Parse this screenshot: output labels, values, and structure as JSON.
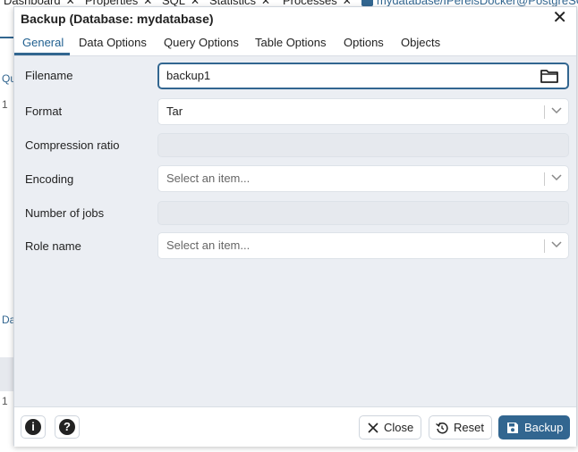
{
  "background": {
    "tabs": [
      "Dashboard",
      "Properties",
      "SQL",
      "Statistics",
      "Processes"
    ],
    "connection_path": "mydatabase/IPereisDocker@PostgreSQ",
    "left_fragments": [
      "Qu",
      "1",
      "Da",
      "1"
    ]
  },
  "dialog": {
    "title": "Backup (Database: mydatabase)",
    "tabs": [
      {
        "label": "General",
        "active": true
      },
      {
        "label": "Data Options"
      },
      {
        "label": "Query Options"
      },
      {
        "label": "Table Options"
      },
      {
        "label": "Options"
      },
      {
        "label": "Objects"
      }
    ],
    "fields": {
      "filename": {
        "label": "Filename",
        "value": "backup1"
      },
      "format": {
        "label": "Format",
        "value": "Tar"
      },
      "compression_ratio": {
        "label": "Compression ratio",
        "value": ""
      },
      "encoding": {
        "label": "Encoding",
        "placeholder": "Select an item..."
      },
      "number_of_jobs": {
        "label": "Number of jobs",
        "value": ""
      },
      "role_name": {
        "label": "Role name",
        "placeholder": "Select an item..."
      }
    },
    "footer": {
      "info_label": "i",
      "help_label": "?",
      "close_label": "Close",
      "reset_label": "Reset",
      "backup_label": "Backup"
    }
  },
  "colors": {
    "accent": "#326690",
    "dialog_bg": "#ebeef3"
  },
  "icons": [
    "folder-icon",
    "chevron-down-icon",
    "close-icon",
    "reset-icon",
    "save-icon",
    "info-icon",
    "help-icon"
  ]
}
